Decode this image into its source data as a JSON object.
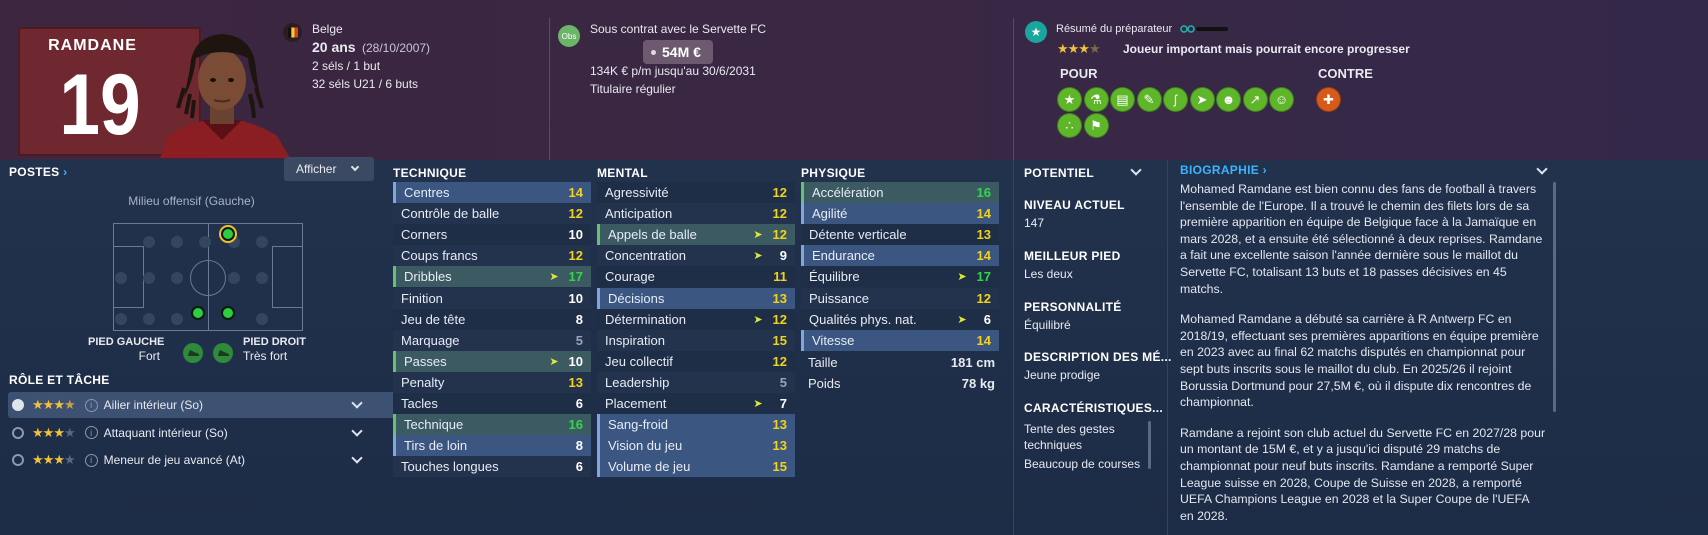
{
  "player": {
    "name": "RAMDANE",
    "number": "19"
  },
  "info": {
    "nationality": "Belge",
    "age": "20 ans",
    "dob": "(28/10/2007)",
    "caps": "2 séls / 1 but",
    "u21": "32 séls U21 / 6 buts"
  },
  "contract": {
    "obs": "Obs",
    "club_line": "Sous contrat avec le Servette FC",
    "value": "54M €",
    "wage": "134K € p/m jusqu'au 30/6/2031",
    "status": "Titulaire régulier"
  },
  "coach": {
    "title": "Résumé du préparateur",
    "stars": 3.5,
    "summary": "Joueur important mais pourrait encore progresser",
    "pour": "POUR",
    "contre": "CONTRE",
    "pour_icons": [
      "star-icon",
      "flask-icon",
      "tactics-icon",
      "boot-icon",
      "dribble-icon",
      "pace-icon",
      "header-icon",
      "trend-up-icon",
      "head-icon",
      "feet-icon",
      "flag-icon"
    ],
    "contre_icons": [
      "injury-icon"
    ],
    "colors": {
      "pour": "#5fb62a",
      "contre": "#d65a1a"
    }
  },
  "positions": {
    "title": "POSTES",
    "button": "Afficher",
    "role": "Milieu offensif (Gauche)",
    "left_foot_label": "PIED GAUCHE",
    "left_foot_val": "Fort",
    "right_foot_label": "PIED DROIT",
    "right_foot_val": "Très fort"
  },
  "roles": {
    "title": "RÔLE ET TÂCHE",
    "items": [
      {
        "label": "Ailier intérieur (So)",
        "stars": 3.5
      },
      {
        "label": "Attaquant intérieur (So)",
        "stars": 3
      },
      {
        "label": "Meneur de jeu avancé (At)",
        "stars": 3
      }
    ]
  },
  "technique": {
    "title": "TECHNIQUE",
    "rows": [
      {
        "l": "Centres",
        "v": "14"
      },
      {
        "l": "Contrôle de balle",
        "v": "12"
      },
      {
        "l": "Corners",
        "v": "10"
      },
      {
        "l": "Coups francs",
        "v": "12"
      },
      {
        "l": "Dribbles",
        "v": "17"
      },
      {
        "l": "Finition",
        "v": "10"
      },
      {
        "l": "Jeu de tête",
        "v": "8"
      },
      {
        "l": "Marquage",
        "v": "5"
      },
      {
        "l": "Passes",
        "v": "10"
      },
      {
        "l": "Penalty",
        "v": "13"
      },
      {
        "l": "Tacles",
        "v": "6"
      },
      {
        "l": "Technique",
        "v": "16"
      },
      {
        "l": "Tirs de loin",
        "v": "8"
      },
      {
        "l": "Touches longues",
        "v": "6"
      }
    ]
  },
  "mental": {
    "title": "MENTAL",
    "rows": [
      {
        "l": "Agressivité",
        "v": "12"
      },
      {
        "l": "Anticipation",
        "v": "12"
      },
      {
        "l": "Appels de balle",
        "v": "12"
      },
      {
        "l": "Concentration",
        "v": "9"
      },
      {
        "l": "Courage",
        "v": "11"
      },
      {
        "l": "Décisions",
        "v": "13"
      },
      {
        "l": "Détermination",
        "v": "12"
      },
      {
        "l": "Inspiration",
        "v": "15"
      },
      {
        "l": "Jeu collectif",
        "v": "12"
      },
      {
        "l": "Leadership",
        "v": "5"
      },
      {
        "l": "Placement",
        "v": "7"
      },
      {
        "l": "Sang-froid",
        "v": "13"
      },
      {
        "l": "Vision du jeu",
        "v": "13"
      },
      {
        "l": "Volume de jeu",
        "v": "15"
      }
    ]
  },
  "physique": {
    "title": "PHYSIQUE",
    "rows": [
      {
        "l": "Accélération",
        "v": "16"
      },
      {
        "l": "Agilité",
        "v": "14"
      },
      {
        "l": "Détente verticale",
        "v": "13"
      },
      {
        "l": "Endurance",
        "v": "14"
      },
      {
        "l": "Équilibre",
        "v": "17"
      },
      {
        "l": "Puissance",
        "v": "12"
      },
      {
        "l": "Qualités phys. nat.",
        "v": "6"
      },
      {
        "l": "Vitesse",
        "v": "14"
      }
    ],
    "height_label": "Taille",
    "height": "181 cm",
    "weight_label": "Poids",
    "weight": "78 kg"
  },
  "side": {
    "potential": "POTENTIEL",
    "level_label": "NIVEAU ACTUEL",
    "level": "147",
    "foot_label": "MEILLEUR PIED",
    "foot": "Les deux",
    "pers_label": "PERSONNALITÉ",
    "pers": "Équilibré",
    "desc_label": "DESCRIPTION DES MÉ...",
    "desc": "Jeune prodige",
    "car_label": "CARACTÉRISTIQUES...",
    "car1": "Tente des gestes techniques",
    "car2": "Beaucoup de courses"
  },
  "bio": {
    "title": "BIOGRAPHIE",
    "p1": "Mohamed Ramdane est bien connu des fans de football à travers l'ensemble de l'Europe. Il a trouvé le chemin des filets lors de sa première apparition en équipe de Belgique face à la Jamaïque en mars 2028, et a ensuite été sélectionné à deux reprises. Ramdane a fait une excellente saison l'année dernière sous le maillot du Servette FC, totalisant 13 buts et 18 passes décisives en 45 matchs.",
    "p2": "Mohamed Ramdane a débuté sa carrière à R Antwerp FC en 2018/19, effectuant ses premières apparitions en équipe première en 2023 avec au final 62 matchs disputés en championnat pour sept buts inscrits sous le maillot du club. En 2025/26 il rejoint Borussia Dortmund pour 27,5M €, où il dispute dix rencontres de championnat.",
    "p3": "Ramdane a rejoint son club actuel du Servette FC en 2027/28 pour un montant de 15M €, et y a jusqu'ici disputé 29 matchs de championnat pour neuf buts inscrits. Ramdane a remporté Super League suisse en 2028, Coupe de Suisse en 2028, a remporté UEFA Champions League en 2028 et la Super Coupe de l'UEFA en 2028."
  }
}
